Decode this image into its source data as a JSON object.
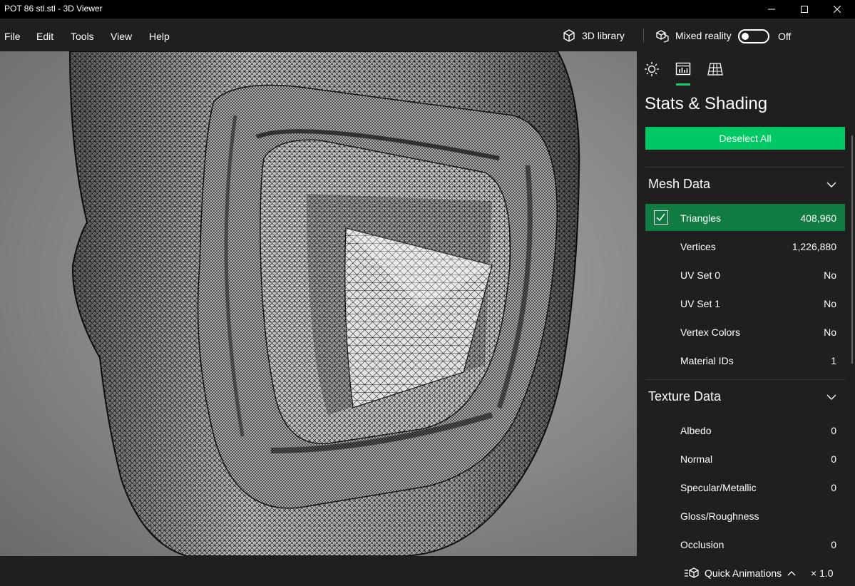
{
  "window": {
    "title": "POT 86 stl.stl - 3D Viewer"
  },
  "menu": {
    "items": [
      "File",
      "Edit",
      "Tools",
      "View",
      "Help"
    ]
  },
  "toolbar": {
    "library_label": "3D library",
    "mixed_reality_label": "Mixed reality",
    "mixed_reality_state": "Off",
    "mixed_reality_on": false
  },
  "panel": {
    "title": "Stats & Shading",
    "deselect_label": "Deselect All",
    "active_tab": "stats",
    "mesh": {
      "header": "Mesh Data",
      "rows": [
        {
          "label": "Triangles",
          "value": "408,960",
          "selected": true
        },
        {
          "label": "Vertices",
          "value": "1,226,880"
        },
        {
          "label": "UV Set 0",
          "value": "No"
        },
        {
          "label": "UV Set 1",
          "value": "No"
        },
        {
          "label": "Vertex Colors",
          "value": "No"
        },
        {
          "label": "Material IDs",
          "value": "1"
        }
      ]
    },
    "texture": {
      "header": "Texture Data",
      "rows": [
        {
          "label": "Albedo",
          "value": "0"
        },
        {
          "label": "Normal",
          "value": "0"
        },
        {
          "label": "Specular/Metallic",
          "value": "0"
        },
        {
          "label": "Gloss/Roughness",
          "value": ""
        },
        {
          "label": "Occlusion",
          "value": "0"
        }
      ]
    }
  },
  "bottom": {
    "quick_animations": "Quick Animations",
    "zoom": "× 1.0"
  },
  "colors": {
    "accent": "#00c864",
    "selected_row": "#107c41",
    "panel_bg": "#1f1f1f"
  }
}
